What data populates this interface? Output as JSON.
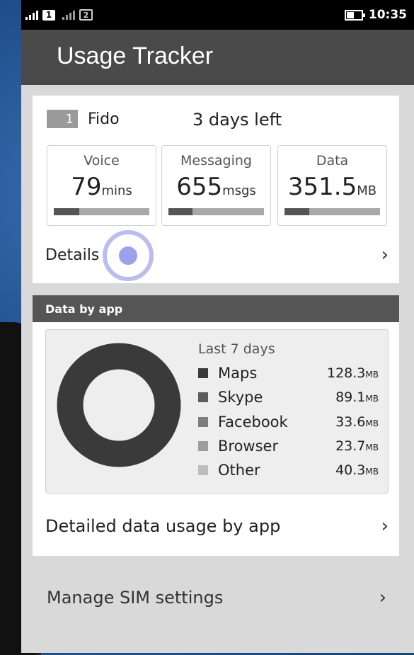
{
  "status_bar": {
    "sim1": "1",
    "sim2": "2",
    "time": "10:35"
  },
  "app": {
    "title": "Usage Tracker"
  },
  "account": {
    "sim_number": "1",
    "carrier": "Fido",
    "days_left": "3 days left"
  },
  "meters": [
    {
      "label": "Voice",
      "value": "79",
      "unit": "mins",
      "used_fraction": 0.27
    },
    {
      "label": "Messaging",
      "value": "655",
      "unit": "msgs",
      "used_fraction": 0.25
    },
    {
      "label": "Data",
      "value": "351.5",
      "unit": "MB",
      "used_fraction": 0.26
    }
  ],
  "details_label": "Details",
  "data_by_app": {
    "header": "Data by app",
    "period": "Last 7 days",
    "apps": [
      {
        "name": "Maps",
        "value": "128.3",
        "unit": "MB",
        "color": "#3a3a3a"
      },
      {
        "name": "Skype",
        "value": "89.1",
        "unit": "MB",
        "color": "#5c5c5c"
      },
      {
        "name": "Facebook",
        "value": "33.6",
        "unit": "MB",
        "color": "#7d7d7d"
      },
      {
        "name": "Browser",
        "value": "23.7",
        "unit": "MB",
        "color": "#9d9d9d"
      },
      {
        "name": "Other",
        "value": "40.3",
        "unit": "MB",
        "color": "#bdbdbd"
      }
    ],
    "donut_color": "#3a3a3a",
    "detail_link": "Detailed data usage by app"
  },
  "manage_sim": "Manage SIM settings",
  "chevron": "›"
}
